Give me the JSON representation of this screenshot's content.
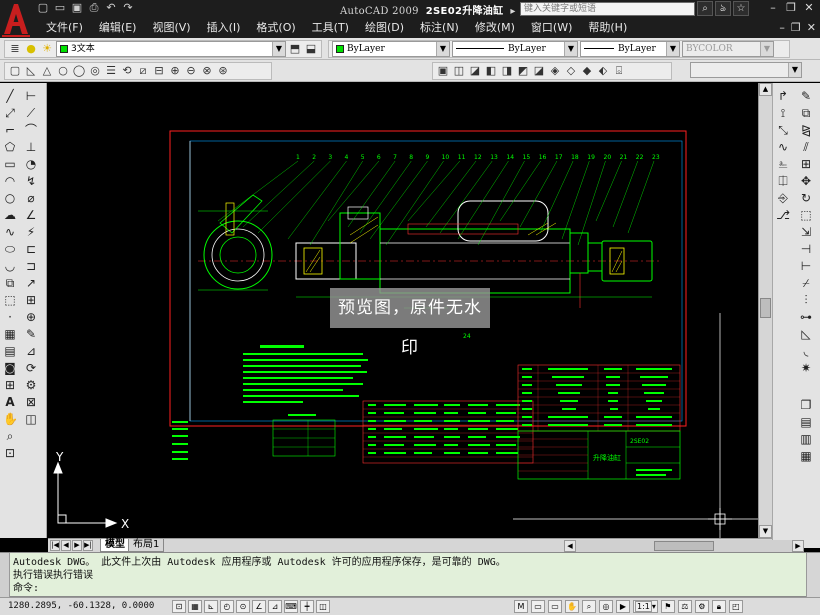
{
  "window": {
    "app_name": "AutoCAD 2009",
    "document_title": "2SE02升降油缸",
    "help_search_placeholder": "键入关键字或短语"
  },
  "menu": [
    "文件(F)",
    "编辑(E)",
    "视图(V)",
    "插入(I)",
    "格式(O)",
    "工具(T)",
    "绘图(D)",
    "标注(N)",
    "修改(M)",
    "窗口(W)",
    "帮助(H)"
  ],
  "layers_toolbar": {
    "current_layer": "3文本"
  },
  "properties_toolbar": {
    "color": "ByLayer",
    "linetype": "ByLayer",
    "lineweight": "ByLayer",
    "plotstyle": "BYCOLOR"
  },
  "layout_tabs": [
    {
      "label": "模型",
      "active": true
    },
    {
      "label": "布局1",
      "active": false
    }
  ],
  "command_line": {
    "history_1": "Autodesk DWG。  此文件上次由 Autodesk 应用程序或 Autodesk 许可的应用程序保存，是可靠的 DWG。",
    "history_2": "执行错误执行错误",
    "prompt": "命令:"
  },
  "status_bar": {
    "coordinates": "1280.2895, -60.1328, 0.0000",
    "annotation_scale": "1:1"
  },
  "watermark": {
    "text": "预览图，原件无水印"
  },
  "drawing": {
    "item_balloons": [
      "1",
      "2",
      "3",
      "4",
      "5",
      "6",
      "7",
      "8",
      "9",
      "10",
      "11",
      "12",
      "13",
      "14",
      "15",
      "16",
      "17",
      "18",
      "19",
      "20",
      "21",
      "22",
      "23"
    ],
    "leader_label": "24",
    "title_block_text": "升降油缸",
    "ucs_x": "X",
    "ucs_y": "Y",
    "title_code": "2SE02"
  },
  "colors": {
    "frame": "#ff2020",
    "geometry": "#00ff00",
    "table_text": "#00ff00",
    "centerline": "#ff3030",
    "hatch": "#ffff00",
    "background": "#000000"
  }
}
